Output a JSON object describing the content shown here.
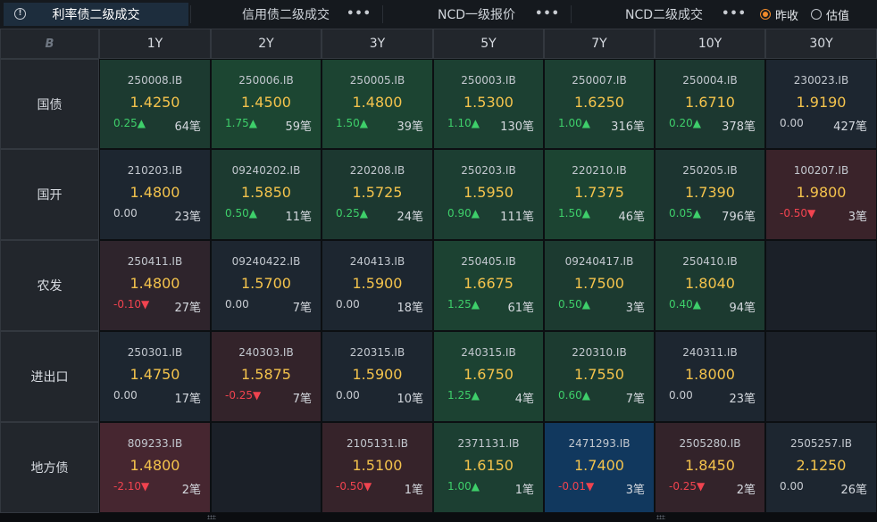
{
  "tabs": [
    {
      "label": "利率债二级成交",
      "active": true,
      "more": "•••"
    },
    {
      "label": "信用债二级成交",
      "active": false,
      "more": "•••"
    },
    {
      "label": "NCD一级报价",
      "active": false,
      "more": "•••"
    },
    {
      "label": "NCD二级成交",
      "active": false,
      "more": "•••"
    }
  ],
  "radios": [
    {
      "label": "昨收",
      "checked": true
    },
    {
      "label": "估值",
      "checked": false
    }
  ],
  "grid": {
    "corner_icon": "B",
    "columns": [
      "1Y",
      "2Y",
      "3Y",
      "5Y",
      "7Y",
      "10Y",
      "30Y"
    ],
    "rows": [
      {
        "label": "国债",
        "cells": [
          {
            "code": "250008.IB",
            "price": "1.4250",
            "change": "0.25▲",
            "dir": "up",
            "count": "64笔",
            "color": "#1c3a30"
          },
          {
            "code": "250006.IB",
            "price": "1.4500",
            "change": "1.75▲",
            "dir": "up",
            "count": "59笔",
            "color": "#1c4632"
          },
          {
            "code": "250005.IB",
            "price": "1.4800",
            "change": "1.50▲",
            "dir": "up",
            "count": "39笔",
            "color": "#1c4432"
          },
          {
            "code": "250003.IB",
            "price": "1.5300",
            "change": "1.10▲",
            "dir": "up",
            "count": "130笔",
            "color": "#1c4032"
          },
          {
            "code": "250007.IB",
            "price": "1.6250",
            "change": "1.00▲",
            "dir": "up",
            "count": "316笔",
            "color": "#1c3f32"
          },
          {
            "code": "250004.IB",
            "price": "1.6710",
            "change": "0.20▲",
            "dir": "up",
            "count": "378笔",
            "color": "#1c3830"
          },
          {
            "code": "230023.IB",
            "price": "1.9190",
            "change": "0.00",
            "dir": "flat",
            "count": "427笔",
            "color": "#1d2630"
          }
        ]
      },
      {
        "label": "国开",
        "cells": [
          {
            "code": "210203.IB",
            "price": "1.4800",
            "change": "0.00",
            "dir": "flat",
            "count": "23笔",
            "color": "#1d2630"
          },
          {
            "code": "09240202.IB",
            "price": "1.5850",
            "change": "0.50▲",
            "dir": "up",
            "count": "11笔",
            "color": "#1c3a30"
          },
          {
            "code": "220208.IB",
            "price": "1.5725",
            "change": "0.25▲",
            "dir": "up",
            "count": "24笔",
            "color": "#1c3830"
          },
          {
            "code": "250203.IB",
            "price": "1.5950",
            "change": "0.90▲",
            "dir": "up",
            "count": "111笔",
            "color": "#1c3e32"
          },
          {
            "code": "220210.IB",
            "price": "1.7375",
            "change": "1.50▲",
            "dir": "up",
            "count": "46笔",
            "color": "#1c4432"
          },
          {
            "code": "250205.IB",
            "price": "1.7390",
            "change": "0.05▲",
            "dir": "up",
            "count": "796笔",
            "color": "#1c3430"
          },
          {
            "code": "100207.IB",
            "price": "1.9800",
            "change": "-0.50▼",
            "dir": "down",
            "count": "3笔",
            "color": "#3a232a"
          }
        ]
      },
      {
        "label": "农发",
        "cells": [
          {
            "code": "250411.IB",
            "price": "1.4800",
            "change": "-0.10▼",
            "dir": "down",
            "count": "27笔",
            "color": "#2e242c"
          },
          {
            "code": "09240422.IB",
            "price": "1.5700",
            "change": "0.00",
            "dir": "flat",
            "count": "7笔",
            "color": "#1d2630"
          },
          {
            "code": "240413.IB",
            "price": "1.5900",
            "change": "0.00",
            "dir": "flat",
            "count": "18笔",
            "color": "#1d2630"
          },
          {
            "code": "250405.IB",
            "price": "1.6675",
            "change": "1.25▲",
            "dir": "up",
            "count": "61笔",
            "color": "#1c4232"
          },
          {
            "code": "09240417.IB",
            "price": "1.7500",
            "change": "0.50▲",
            "dir": "up",
            "count": "3笔",
            "color": "#1c3a30"
          },
          {
            "code": "250410.IB",
            "price": "1.8040",
            "change": "0.40▲",
            "dir": "up",
            "count": "94笔",
            "color": "#1c3a30"
          },
          {
            "code": "",
            "price": "",
            "change": "",
            "dir": "flat",
            "count": "",
            "color": "#1b2028"
          }
        ]
      },
      {
        "label": "进出口",
        "cells": [
          {
            "code": "250301.IB",
            "price": "1.4750",
            "change": "0.00",
            "dir": "flat",
            "count": "17笔",
            "color": "#1d2630"
          },
          {
            "code": "240303.IB",
            "price": "1.5875",
            "change": "-0.25▼",
            "dir": "down",
            "count": "7笔",
            "color": "#33232a"
          },
          {
            "code": "220315.IB",
            "price": "1.5900",
            "change": "0.00",
            "dir": "flat",
            "count": "10笔",
            "color": "#1d2630"
          },
          {
            "code": "240315.IB",
            "price": "1.6750",
            "change": "1.25▲",
            "dir": "up",
            "count": "4笔",
            "color": "#1c4232"
          },
          {
            "code": "220310.IB",
            "price": "1.7550",
            "change": "0.60▲",
            "dir": "up",
            "count": "7笔",
            "color": "#1c3b30"
          },
          {
            "code": "240311.IB",
            "price": "1.8000",
            "change": "0.00",
            "dir": "flat",
            "count": "23笔",
            "color": "#1d2630"
          },
          {
            "code": "",
            "price": "",
            "change": "",
            "dir": "flat",
            "count": "",
            "color": "#1b2028"
          }
        ]
      },
      {
        "label": "地方债",
        "cells": [
          {
            "code": "809233.IB",
            "price": "1.4800",
            "change": "-2.10▼",
            "dir": "down",
            "count": "2笔",
            "color": "#462630"
          },
          {
            "code": "",
            "price": "",
            "change": "",
            "dir": "flat",
            "count": "",
            "color": "#1b2028"
          },
          {
            "code": "2105131.IB",
            "price": "1.5100",
            "change": "-0.50▼",
            "dir": "down",
            "count": "1笔",
            "color": "#36232a"
          },
          {
            "code": "2371131.IB",
            "price": "1.6150",
            "change": "1.00▲",
            "dir": "up",
            "count": "1笔",
            "color": "#1c3f32"
          },
          {
            "code": "2471293.IB",
            "price": "1.7400",
            "change": "-0.01▼",
            "dir": "down",
            "count": "3笔",
            "color": "#11385e"
          },
          {
            "code": "2505280.IB",
            "price": "1.8450",
            "change": "-0.25▼",
            "dir": "down",
            "count": "2笔",
            "color": "#33232a"
          },
          {
            "code": "2505257.IB",
            "price": "2.1250",
            "change": "0.00",
            "dir": "flat",
            "count": "26笔",
            "color": "#1d2630"
          }
        ]
      }
    ]
  }
}
